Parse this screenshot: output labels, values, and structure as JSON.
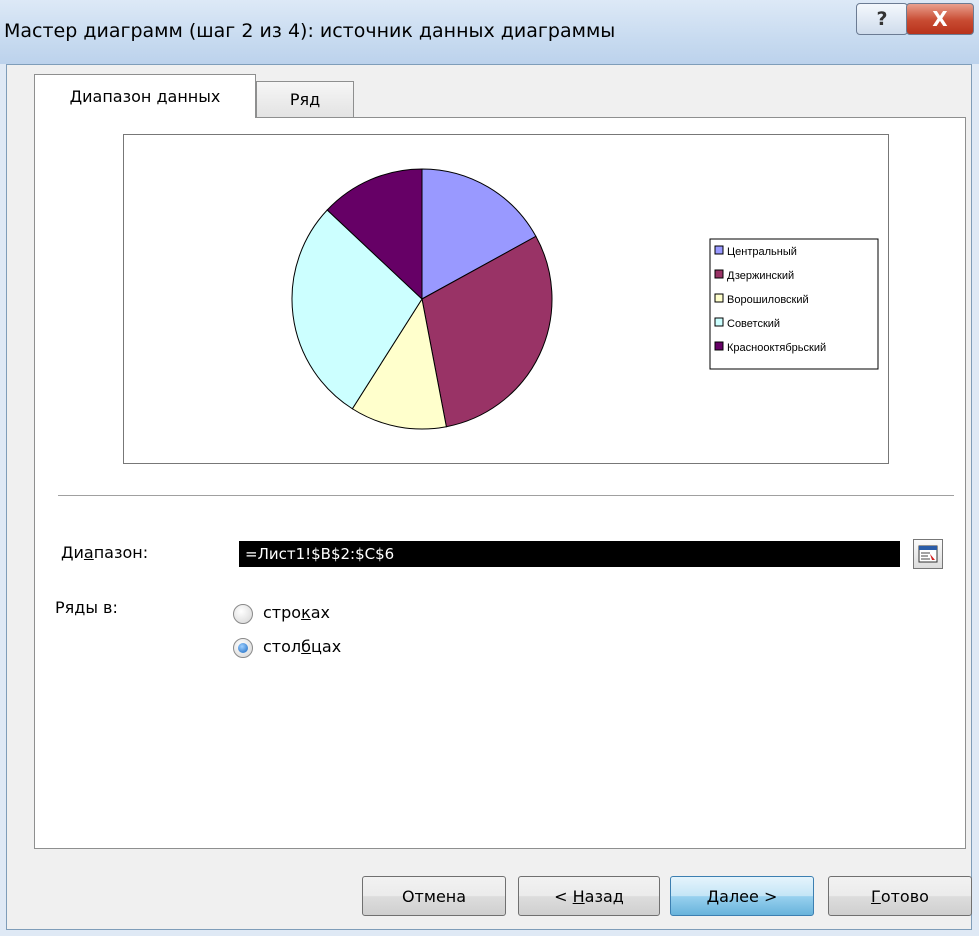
{
  "window": {
    "title": "Мастер диаграмм (шаг 2 из 4): источник данных диаграммы",
    "help_glyph": "?",
    "close_glyph": "X"
  },
  "tabs": [
    {
      "label": "Диапазон данных",
      "active": true
    },
    {
      "label": "Ряд",
      "active": false
    }
  ],
  "chart_data": {
    "type": "pie",
    "categories": [
      "Центральный",
      "Дзержинский",
      "Ворошиловский",
      "Советский",
      "Краснооктябрьский"
    ],
    "values": [
      17,
      30,
      12,
      28,
      13
    ],
    "colors": [
      "#9999ff",
      "#993366",
      "#ffffcc",
      "#ccffff",
      "#660066"
    ],
    "legend_position": "right"
  },
  "form": {
    "range_label_pre": "Ди",
    "range_label_u": "а",
    "range_label_post": "пазон:",
    "range_value": "=Лист1!$B$2:$C$6",
    "series_in_label": "Ряды в:",
    "rows_pre": "стро",
    "rows_u": "к",
    "rows_post": "ах",
    "cols_pre": "стол",
    "cols_u": "б",
    "cols_post": "цах",
    "selected": "columns"
  },
  "buttons": {
    "cancel": "Отмена",
    "back_pre": "< ",
    "back_u": "Н",
    "back_post": "азад",
    "next_u": "Д",
    "next_post": "алее >",
    "finish_u": "Г",
    "finish_post": "отово"
  }
}
